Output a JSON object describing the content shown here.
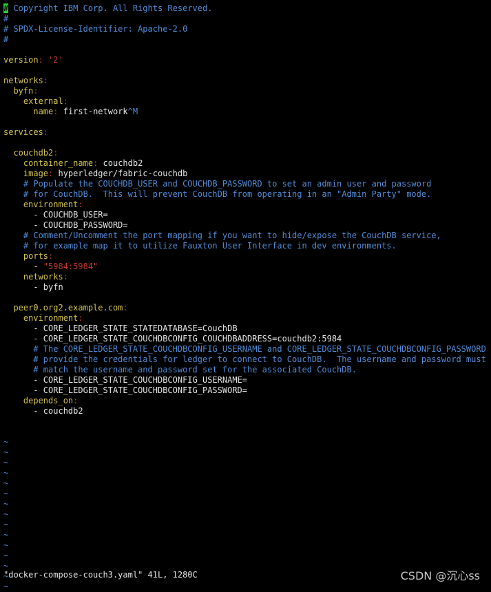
{
  "colors": {
    "background": "#000000",
    "comment": "#4f8bd6",
    "key": "#d4c24a",
    "colon": "#c0392b",
    "string": "#c0392b",
    "text": "#e6e6e6",
    "cursor": "#22c93a",
    "tilde": "#4f8bd6"
  },
  "editor": {
    "lines": [
      [
        {
          "t": "#",
          "c": "cursor"
        },
        {
          "t": " Copyright IBM Corp. All Rights Reserved.",
          "c": "comment"
        }
      ],
      [
        {
          "t": "#",
          "c": "comment"
        }
      ],
      [
        {
          "t": "# SPDX-License-Identifier: Apache-2.0",
          "c": "comment"
        }
      ],
      [
        {
          "t": "#",
          "c": "comment"
        }
      ],
      [],
      [
        {
          "t": "version",
          "c": "key"
        },
        {
          "t": ": ",
          "c": "colon"
        },
        {
          "t": "'2'",
          "c": "string"
        }
      ],
      [],
      [
        {
          "t": "networks",
          "c": "key"
        },
        {
          "t": ":",
          "c": "colon"
        }
      ],
      [
        {
          "t": "  "
        },
        {
          "t": "byfn",
          "c": "key"
        },
        {
          "t": ":",
          "c": "colon"
        }
      ],
      [
        {
          "t": "    "
        },
        {
          "t": "external",
          "c": "key"
        },
        {
          "t": ":",
          "c": "colon"
        }
      ],
      [
        {
          "t": "      "
        },
        {
          "t": "name",
          "c": "key"
        },
        {
          "t": ": ",
          "c": "colon"
        },
        {
          "t": "first-network",
          "c": "text"
        },
        {
          "t": "^M",
          "c": "comment"
        }
      ],
      [],
      [
        {
          "t": "services",
          "c": "key"
        },
        {
          "t": ":",
          "c": "colon"
        }
      ],
      [],
      [
        {
          "t": "  "
        },
        {
          "t": "couchdb2",
          "c": "key"
        },
        {
          "t": ":",
          "c": "colon"
        }
      ],
      [
        {
          "t": "    "
        },
        {
          "t": "container_name",
          "c": "key"
        },
        {
          "t": ": ",
          "c": "colon"
        },
        {
          "t": "couchdb2",
          "c": "text"
        }
      ],
      [
        {
          "t": "    "
        },
        {
          "t": "image",
          "c": "key"
        },
        {
          "t": ": ",
          "c": "colon"
        },
        {
          "t": "hyperledger/fabric-couchdb",
          "c": "text"
        }
      ],
      [
        {
          "t": "    # Populate the COUCHDB_USER and COUCHDB_PASSWORD to set an admin user and password",
          "c": "comment"
        }
      ],
      [
        {
          "t": "    # for CouchDB.  This will prevent CouchDB from operating in an \"Admin Party\" mode.",
          "c": "comment"
        }
      ],
      [
        {
          "t": "    "
        },
        {
          "t": "environment",
          "c": "key"
        },
        {
          "t": ":",
          "c": "colon"
        }
      ],
      [
        {
          "t": "      - ",
          "c": "text"
        },
        {
          "t": "COUCHDB_USER=",
          "c": "text"
        }
      ],
      [
        {
          "t": "      - ",
          "c": "text"
        },
        {
          "t": "COUCHDB_PASSWORD=",
          "c": "text"
        }
      ],
      [
        {
          "t": "    # Comment/Uncomment the port mapping if you want to hide/expose the CouchDB service,",
          "c": "comment"
        }
      ],
      [
        {
          "t": "    # for example map it to utilize Fauxton User Interface in dev environments.",
          "c": "comment"
        }
      ],
      [
        {
          "t": "    "
        },
        {
          "t": "ports",
          "c": "key"
        },
        {
          "t": ":",
          "c": "colon"
        }
      ],
      [
        {
          "t": "      - ",
          "c": "text"
        },
        {
          "t": "\"5984:5984\"",
          "c": "string"
        }
      ],
      [
        {
          "t": "    "
        },
        {
          "t": "networks",
          "c": "key"
        },
        {
          "t": ":",
          "c": "colon"
        }
      ],
      [
        {
          "t": "      - ",
          "c": "text"
        },
        {
          "t": "byfn",
          "c": "text"
        }
      ],
      [],
      [
        {
          "t": "  "
        },
        {
          "t": "peer0.org2.example.com",
          "c": "key"
        },
        {
          "t": ":",
          "c": "colon"
        }
      ],
      [
        {
          "t": "    "
        },
        {
          "t": "environment",
          "c": "key"
        },
        {
          "t": ":",
          "c": "colon"
        }
      ],
      [
        {
          "t": "      - ",
          "c": "text"
        },
        {
          "t": "CORE_LEDGER_STATE_STATEDATABASE=CouchDB",
          "c": "text"
        }
      ],
      [
        {
          "t": "      - ",
          "c": "text"
        },
        {
          "t": "CORE_LEDGER_STATE_COUCHDBCONFIG_COUCHDBADDRESS=couchdb2:5984",
          "c": "text"
        }
      ],
      [
        {
          "t": "      # The CORE_LEDGER_STATE_COUCHDBCONFIG_USERNAME and CORE_LEDGER_STATE_COUCHDBCONFIG_PASSWORD",
          "c": "comment"
        }
      ],
      [
        {
          "t": "      # provide the credentials for ledger to connect to CouchDB.  The username and password must",
          "c": "comment"
        }
      ],
      [
        {
          "t": "      # match the username and password set for the associated CouchDB.",
          "c": "comment"
        }
      ],
      [
        {
          "t": "      - ",
          "c": "text"
        },
        {
          "t": "CORE_LEDGER_STATE_COUCHDBCONFIG_USERNAME=",
          "c": "text"
        }
      ],
      [
        {
          "t": "      - ",
          "c": "text"
        },
        {
          "t": "CORE_LEDGER_STATE_COUCHDBCONFIG_PASSWORD=",
          "c": "text"
        }
      ],
      [
        {
          "t": "    "
        },
        {
          "t": "depends_on",
          "c": "key"
        },
        {
          "t": ":",
          "c": "colon"
        }
      ],
      [
        {
          "t": "      - ",
          "c": "text"
        },
        {
          "t": "couchdb2",
          "c": "text"
        }
      ],
      [],
      [],
      [
        {
          "t": "~",
          "c": "tilde"
        }
      ],
      [
        {
          "t": "~",
          "c": "tilde"
        }
      ],
      [
        {
          "t": "~",
          "c": "tilde"
        }
      ],
      [
        {
          "t": "~",
          "c": "tilde"
        }
      ],
      [
        {
          "t": "~",
          "c": "tilde"
        }
      ],
      [
        {
          "t": "~",
          "c": "tilde"
        }
      ],
      [
        {
          "t": "~",
          "c": "tilde"
        }
      ],
      [
        {
          "t": "~",
          "c": "tilde"
        }
      ],
      [
        {
          "t": "~",
          "c": "tilde"
        }
      ],
      [
        {
          "t": "~",
          "c": "tilde"
        }
      ],
      [
        {
          "t": "~",
          "c": "tilde"
        }
      ],
      [
        {
          "t": "~",
          "c": "tilde"
        }
      ],
      [
        {
          "t": "~",
          "c": "tilde"
        }
      ],
      [
        {
          "t": "~",
          "c": "tilde"
        }
      ],
      [
        {
          "t": "~",
          "c": "tilde"
        }
      ]
    ]
  },
  "statusbar": {
    "message": "\"docker-compose-couch3.yaml\" 41L, 1280C"
  },
  "watermark": {
    "text": "CSDN @沉心ss"
  }
}
